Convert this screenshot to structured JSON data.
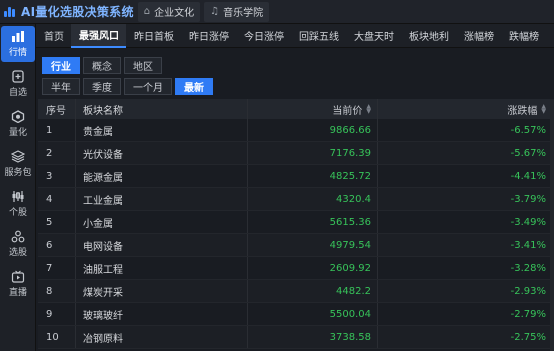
{
  "app": {
    "title": "AI量化选股决策系统"
  },
  "title_tabs": [
    {
      "icon": "home-icon",
      "label": "企业文化"
    },
    {
      "icon": "music-icon",
      "label": "音乐学院"
    }
  ],
  "rail": [
    {
      "icon": "market-icon",
      "label": "行情",
      "active": true
    },
    {
      "icon": "add-watch-icon",
      "label": "自选"
    },
    {
      "icon": "quant-icon",
      "label": "量化"
    },
    {
      "icon": "package-icon",
      "label": "服务包"
    },
    {
      "icon": "stock-icon",
      "label": "个股"
    },
    {
      "icon": "pick-icon",
      "label": "选股"
    },
    {
      "icon": "live-icon",
      "label": "直播"
    }
  ],
  "nav": [
    "首页",
    "最强风口",
    "昨日首板",
    "昨日涨停",
    "今日涨停",
    "回踩五线",
    "大盘天时",
    "板块地利",
    "涨幅榜",
    "跌幅榜",
    "龙虎"
  ],
  "nav_active": 1,
  "filters": {
    "row1": [
      "行业",
      "概念",
      "地区"
    ],
    "row1_active": 0,
    "row2": [
      "半年",
      "季度",
      "一个月",
      "最新"
    ],
    "row2_active": 3
  },
  "table": {
    "headers": {
      "no": "序号",
      "name": "板块名称",
      "price": "当前价",
      "change": "涨跌幅"
    },
    "rows": [
      {
        "no": "1",
        "name": "贵金属",
        "price": "9866.66",
        "change": "-6.57%"
      },
      {
        "no": "2",
        "name": "光伏设备",
        "price": "7176.39",
        "change": "-5.67%"
      },
      {
        "no": "3",
        "name": "能源金属",
        "price": "4825.72",
        "change": "-4.41%"
      },
      {
        "no": "4",
        "name": "工业金属",
        "price": "4320.4",
        "change": "-3.79%"
      },
      {
        "no": "5",
        "name": "小金属",
        "price": "5615.36",
        "change": "-3.49%"
      },
      {
        "no": "6",
        "name": "电网设备",
        "price": "4979.54",
        "change": "-3.41%"
      },
      {
        "no": "7",
        "name": "油服工程",
        "price": "2609.92",
        "change": "-3.28%"
      },
      {
        "no": "8",
        "name": "煤炭开采",
        "price": "4482.2",
        "change": "-2.93%"
      },
      {
        "no": "9",
        "name": "玻璃玻纤",
        "price": "5500.04",
        "change": "-2.79%"
      },
      {
        "no": "10",
        "name": "冶钢原料",
        "price": "3738.58",
        "change": "-2.75%"
      }
    ]
  },
  "colors": {
    "accent": "#2f7bf5",
    "down": "#37c35a"
  }
}
